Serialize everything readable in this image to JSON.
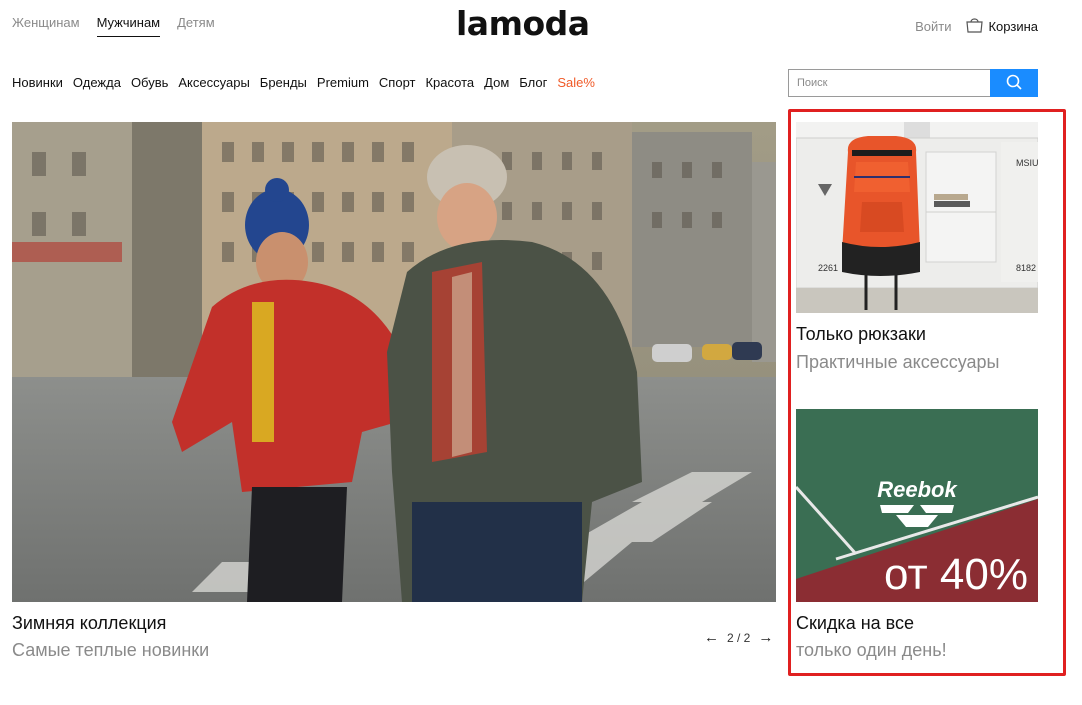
{
  "gender_tabs": [
    {
      "label": "Женщинам",
      "active": false
    },
    {
      "label": "Мужчинам",
      "active": true
    },
    {
      "label": "Детям",
      "active": false
    }
  ],
  "logo": "lamoda",
  "header": {
    "login": "Войти",
    "cart": "Корзина"
  },
  "categories": [
    "Новинки",
    "Одежда",
    "Обувь",
    "Аксессуары",
    "Бренды",
    "Premium",
    "Спорт",
    "Красота",
    "Дом",
    "Блог",
    "Sale%"
  ],
  "search": {
    "placeholder": "Поиск",
    "value": ""
  },
  "hero": {
    "title": "Зимняя коллекция",
    "subtitle": "Самые теплые новинки",
    "pager": "2 / 2"
  },
  "promos": [
    {
      "title": "Только рюкзаки",
      "subtitle": "Практичные аксессуары"
    },
    {
      "title": "Скидка на все",
      "subtitle": "только один день!",
      "brand": "Reebok",
      "discount": "от 40%"
    }
  ],
  "locker_labels": [
    "MSIU",
    "2261",
    "8182"
  ],
  "colors": {
    "accent_blue": "#1a8cff",
    "sale": "#f05a28",
    "highlight_frame": "#e02020",
    "muted_text": "#8a8a8a"
  }
}
